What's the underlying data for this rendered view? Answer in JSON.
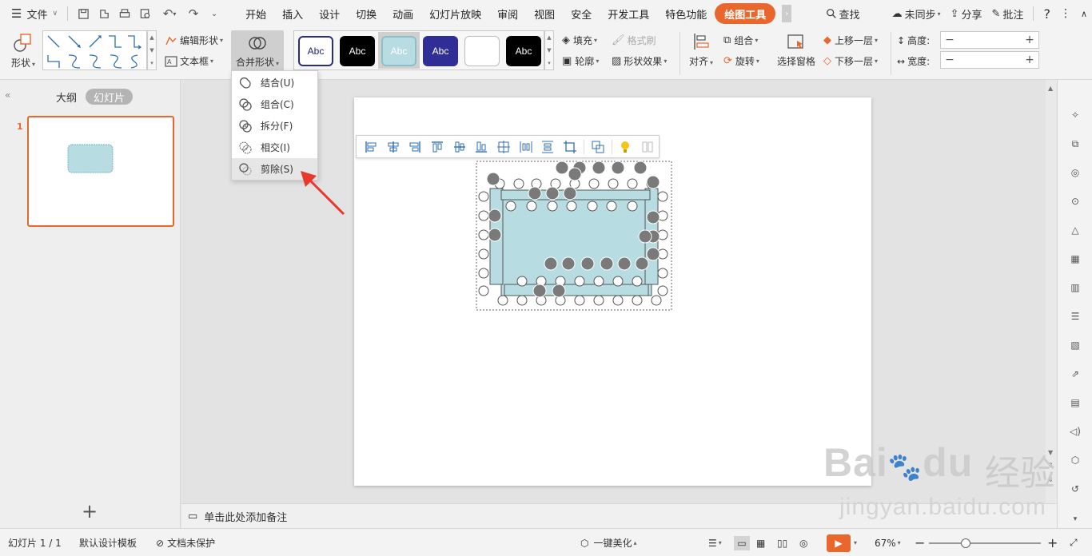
{
  "menubar": {
    "file_label": "文件",
    "tabs": [
      "开始",
      "插入",
      "设计",
      "切换",
      "动画",
      "幻灯片放映",
      "审阅",
      "视图",
      "安全",
      "开发工具",
      "特色功能",
      "绘图工具"
    ],
    "active_tab": "绘图工具",
    "search_label": "查找",
    "sync_label": "未同步",
    "share_label": "分享",
    "comment_label": "批注",
    "help_label": "?"
  },
  "ribbon": {
    "shape_label": "形状",
    "edit_shape_label": "编辑形状",
    "textbox_label": "文本框",
    "merge_shape_label": "合并形状",
    "style_swatches": [
      {
        "text": "Abc",
        "bg": "#ffffff",
        "fg": "#1f1f7a",
        "border": "#2b2b8a"
      },
      {
        "text": "Abc",
        "bg": "#000000",
        "fg": "#ffffff",
        "border": "#000000"
      },
      {
        "text": "Abc",
        "bg": "#b7dde2",
        "fg": "#ffffff",
        "border": "#8fbfc6"
      },
      {
        "text": "Abc",
        "bg": "#2e2e96",
        "fg": "#ffffff",
        "border": "#2e2e96"
      },
      {
        "text": "",
        "bg": "#ffffff",
        "fg": "#000000",
        "border": "#bdbdbd"
      },
      {
        "text": "Abc",
        "bg": "#000000",
        "fg": "#ffffff",
        "border": "#000000"
      }
    ],
    "fill_label": "填充",
    "format_brush_label": "格式刷",
    "outline_label": "轮廓",
    "shape_effect_label": "形状效果",
    "align_label": "对齐",
    "group_label": "组合",
    "rotate_label": "旋转",
    "selection_pane_label": "选择窗格",
    "bring_forward_label": "上移一层",
    "send_backward_label": "下移一层",
    "height_label": "高度:",
    "width_label": "宽度:"
  },
  "dropdown": {
    "items": [
      "结合(U)",
      "组合(C)",
      "拆分(F)",
      "相交(I)",
      "剪除(S)"
    ],
    "highlighted": "剪除(S)"
  },
  "left_panel": {
    "outline_tab": "大纲",
    "slides_tab": "幻灯片",
    "slide_number": "1",
    "add_label": "+"
  },
  "notes": {
    "placeholder": "单击此处添加备注"
  },
  "statusbar": {
    "slide_info": "幻灯片 1 / 1",
    "template": "默认设计模板",
    "protect": "文档未保护",
    "beautify": "一键美化",
    "zoom": "67%"
  },
  "watermark": {
    "brand_text": "Bai",
    "brand_text2": "du",
    "cn_text": "经验",
    "url": "jingyan.baidu.com"
  },
  "colors": {
    "accent": "#e9662c",
    "shape_fill": "#b7dde2",
    "arrow_red": "#e8392f"
  }
}
